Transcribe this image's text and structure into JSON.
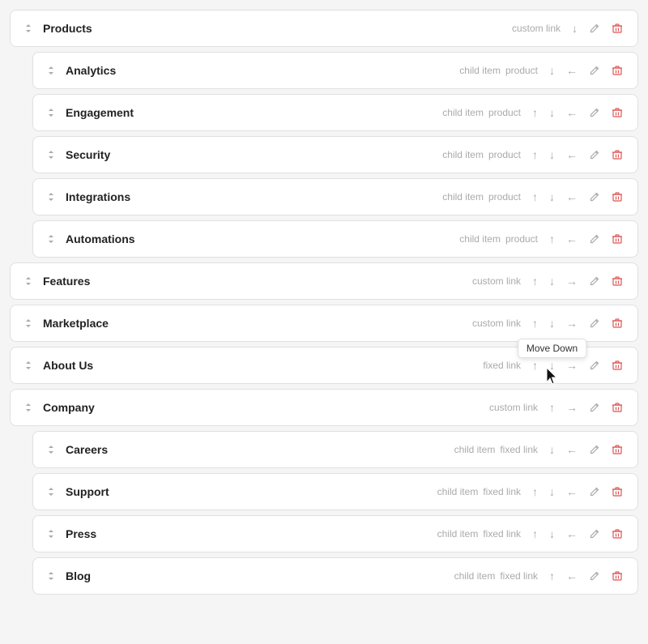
{
  "items": [
    {
      "id": "products",
      "name": "Products",
      "indent": false,
      "tags": [
        "custom link"
      ],
      "actions": [
        "up-down",
        "down",
        "edit",
        "delete"
      ],
      "showUpArrow": false,
      "showDownArrow": true,
      "showLeftArrow": false,
      "showRightArrow": false
    },
    {
      "id": "analytics",
      "name": "Analytics",
      "indent": true,
      "tags": [
        "child item",
        "product"
      ],
      "showUpArrow": false,
      "showDownArrow": true,
      "showLeftArrow": true,
      "showRightArrow": false
    },
    {
      "id": "engagement",
      "name": "Engagement",
      "indent": true,
      "tags": [
        "child item",
        "product"
      ],
      "showUpArrow": true,
      "showDownArrow": true,
      "showLeftArrow": true,
      "showRightArrow": false
    },
    {
      "id": "security",
      "name": "Security",
      "indent": true,
      "tags": [
        "child item",
        "product"
      ],
      "showUpArrow": true,
      "showDownArrow": true,
      "showLeftArrow": true,
      "showRightArrow": false
    },
    {
      "id": "integrations",
      "name": "Integrations",
      "indent": true,
      "tags": [
        "child item",
        "product"
      ],
      "showUpArrow": true,
      "showDownArrow": true,
      "showLeftArrow": true,
      "showRightArrow": false
    },
    {
      "id": "automations",
      "name": "Automations",
      "indent": true,
      "tags": [
        "child item",
        "product"
      ],
      "showUpArrow": true,
      "showDownArrow": false,
      "showLeftArrow": true,
      "showRightArrow": false
    },
    {
      "id": "features",
      "name": "Features",
      "indent": false,
      "tags": [
        "custom link"
      ],
      "showUpArrow": true,
      "showDownArrow": true,
      "showLeftArrow": false,
      "showRightArrow": true
    },
    {
      "id": "marketplace",
      "name": "Marketplace",
      "indent": false,
      "tags": [
        "custom link"
      ],
      "showUpArrow": true,
      "showDownArrow": true,
      "showLeftArrow": false,
      "showRightArrow": true,
      "tooltip": "Move Down"
    },
    {
      "id": "about-us",
      "name": "About Us",
      "indent": false,
      "tags": [
        "fixed link"
      ],
      "showUpArrow": true,
      "showDownArrow": true,
      "showLeftArrow": false,
      "showRightArrow": true
    },
    {
      "id": "company",
      "name": "Company",
      "indent": false,
      "tags": [
        "custom link"
      ],
      "showUpArrow": true,
      "showDownArrow": false,
      "showLeftArrow": false,
      "showRightArrow": true
    },
    {
      "id": "careers",
      "name": "Careers",
      "indent": true,
      "tags": [
        "child item",
        "fixed link"
      ],
      "showUpArrow": false,
      "showDownArrow": true,
      "showLeftArrow": true,
      "showRightArrow": false
    },
    {
      "id": "support",
      "name": "Support",
      "indent": true,
      "tags": [
        "child item",
        "fixed link"
      ],
      "showUpArrow": true,
      "showDownArrow": true,
      "showLeftArrow": true,
      "showRightArrow": false
    },
    {
      "id": "press",
      "name": "Press",
      "indent": true,
      "tags": [
        "child item",
        "fixed link"
      ],
      "showUpArrow": true,
      "showDownArrow": true,
      "showLeftArrow": true,
      "showRightArrow": false
    },
    {
      "id": "blog",
      "name": "Blog",
      "indent": true,
      "tags": [
        "child item",
        "fixed link"
      ],
      "showUpArrow": true,
      "showDownArrow": false,
      "showLeftArrow": true,
      "showRightArrow": false
    }
  ],
  "tooltip": {
    "move_down": "Move Down"
  }
}
